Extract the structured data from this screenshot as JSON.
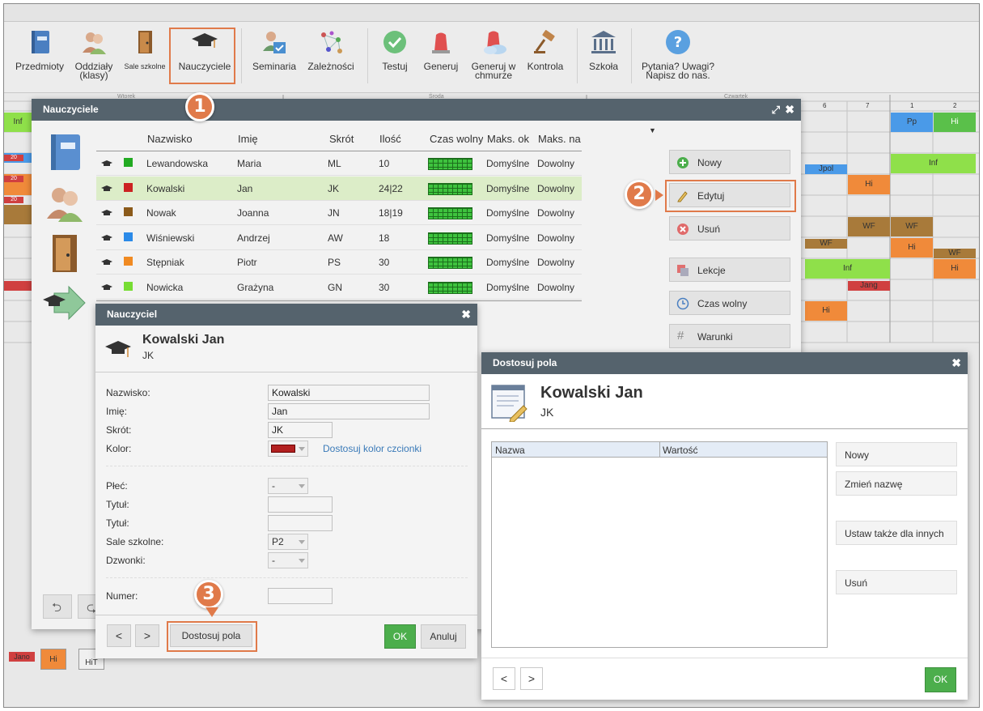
{
  "toolbar": {
    "przedmioty": "Przedmioty",
    "oddzialy": "Oddziały",
    "oddzialy2": "(klasy)",
    "sale": "Sale szkolne",
    "nauczyciele": "Nauczyciele",
    "seminaria": "Seminaria",
    "zaleznosci": "Zależności",
    "testuj": "Testuj",
    "generuj": "Generuj",
    "generuj_chmurze1": "Generuj w",
    "generuj_chmurze2": "chmurze",
    "kontrola": "Kontrola",
    "szkola": "Szkoła",
    "pytania1": "Pytania? Uwagi?",
    "pytania2": "Napisz do nas."
  },
  "steps": [
    "1",
    "2",
    "3"
  ],
  "grid": {
    "day1": "Wtorek",
    "day2": "Środa",
    "day3": "Czwartek",
    "cols": [
      "6",
      "7",
      "1",
      "2"
    ],
    "cells": [
      "Inf",
      "Pp",
      "Hi",
      "Jpol",
      "Inf",
      "Hi",
      "WF",
      "WF",
      "WF",
      "Hi",
      "WF",
      "Inf",
      "Hi",
      "Jang",
      "Hi",
      "Jano",
      "Hi",
      "HiT",
      "20",
      "20",
      "20"
    ]
  },
  "teachers_window": {
    "title": "Nauczyciele",
    "columns": [
      "Nazwisko",
      "Imię",
      "Skrót",
      "Ilość",
      "Czas wolny",
      "Maks. ok",
      "Maks. na"
    ],
    "rows": [
      {
        "nazwisko": "Lewandowska",
        "imie": "Maria",
        "skrot": "ML",
        "ilosc": "10",
        "maks_ok": "Domyślne",
        "maks_na": "Dowolny",
        "color": "#22aa22"
      },
      {
        "nazwisko": "Kowalski",
        "imie": "Jan",
        "skrot": "JK",
        "ilosc": "24|22",
        "maks_ok": "Domyślne",
        "maks_na": "Dowolny",
        "color": "#cc2222"
      },
      {
        "nazwisko": "Nowak",
        "imie": "Joanna",
        "skrot": "JN",
        "ilosc": "18|19",
        "maks_ok": "Domyślne",
        "maks_na": "Dowolny",
        "color": "#8b5a1a"
      },
      {
        "nazwisko": "Wiśniewski",
        "imie": "Andrzej",
        "skrot": "AW",
        "ilosc": "18",
        "maks_ok": "Domyślne",
        "maks_na": "Dowolny",
        "color": "#2b8ae8"
      },
      {
        "nazwisko": "Stępniak",
        "imie": "Piotr",
        "skrot": "PS",
        "ilosc": "30",
        "maks_ok": "Domyślne",
        "maks_na": "Dowolny",
        "color": "#f08a22"
      },
      {
        "nazwisko": "Nowicka",
        "imie": "Grażyna",
        "skrot": "GN",
        "ilosc": "30",
        "maks_ok": "Domyślne",
        "maks_na": "Dowolny",
        "color": "#77dd33"
      }
    ],
    "buttons": {
      "nowy": "Nowy",
      "edytuj": "Edytuj",
      "usun": "Usuń",
      "lekcje": "Lekcje",
      "czas_wolny": "Czas wolny",
      "warunki": "Warunki"
    }
  },
  "teacher_dialog": {
    "title": "Nauczyciel",
    "name": "Kowalski Jan",
    "short": "JK",
    "labels": {
      "nazwisko": "Nazwisko:",
      "imie": "Imię:",
      "skrot": "Skrót:",
      "kolor": "Kolor:",
      "plec": "Płeć:",
      "tytul1": "Tytuł:",
      "tytul2": "Tytuł:",
      "sale": "Sale szkolne:",
      "dzwonki": "Dzwonki:",
      "numer": "Numer:"
    },
    "values": {
      "nazwisko": "Kowalski",
      "imie": "Jan",
      "skrot": "JK",
      "kolor": "#b22020",
      "plec": "-",
      "sale": "P2",
      "dzwonki": "-"
    },
    "font_color_link": "Dostosuj kolor czcionki",
    "prev": "<",
    "next": ">",
    "custom_fields": "Dostosuj pola",
    "ok": "OK",
    "cancel": "Anuluj"
  },
  "custom_dialog": {
    "title": "Dostosuj pola",
    "name": "Kowalski Jan",
    "short": "JK",
    "col_name": "Nazwa",
    "col_value": "Wartość",
    "buttons": {
      "nowy": "Nowy",
      "zmien": "Zmień nazwę",
      "ustaw": "Ustaw także dla innych",
      "usun": "Usuń"
    },
    "prev": "<",
    "next": ">",
    "ok": "OK"
  },
  "colors": {
    "accent": "#e07a4a",
    "titlebar": "#55636d",
    "ok_green": "#4cae4c",
    "selected_row": "#dcedc8"
  }
}
